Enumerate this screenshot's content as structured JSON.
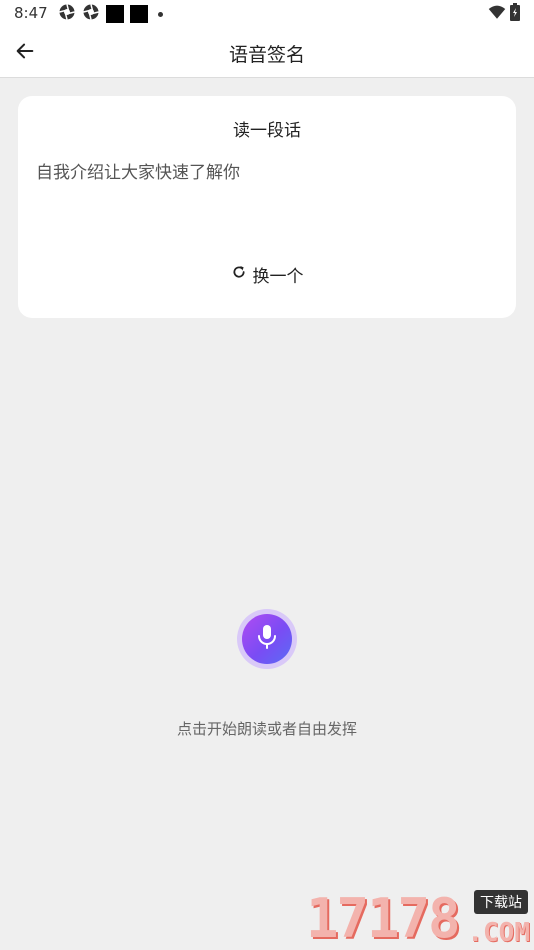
{
  "status_bar": {
    "time": "8:47"
  },
  "app_bar": {
    "title": "语音签名"
  },
  "card": {
    "title": "读一段话",
    "text": "自我介绍让大家快速了解你",
    "refresh_label": "换一个"
  },
  "recorder": {
    "hint": "点击开始朗读或者自由发挥"
  },
  "watermark": {
    "digits": "17178",
    "badge": "下载站",
    "suffix": ".COM"
  },
  "colors": {
    "mic_gradient_start": "#b14cf2",
    "mic_gradient_end": "#5a6cf5",
    "mic_ring": "#d9c9f8",
    "background": "#efefef"
  }
}
